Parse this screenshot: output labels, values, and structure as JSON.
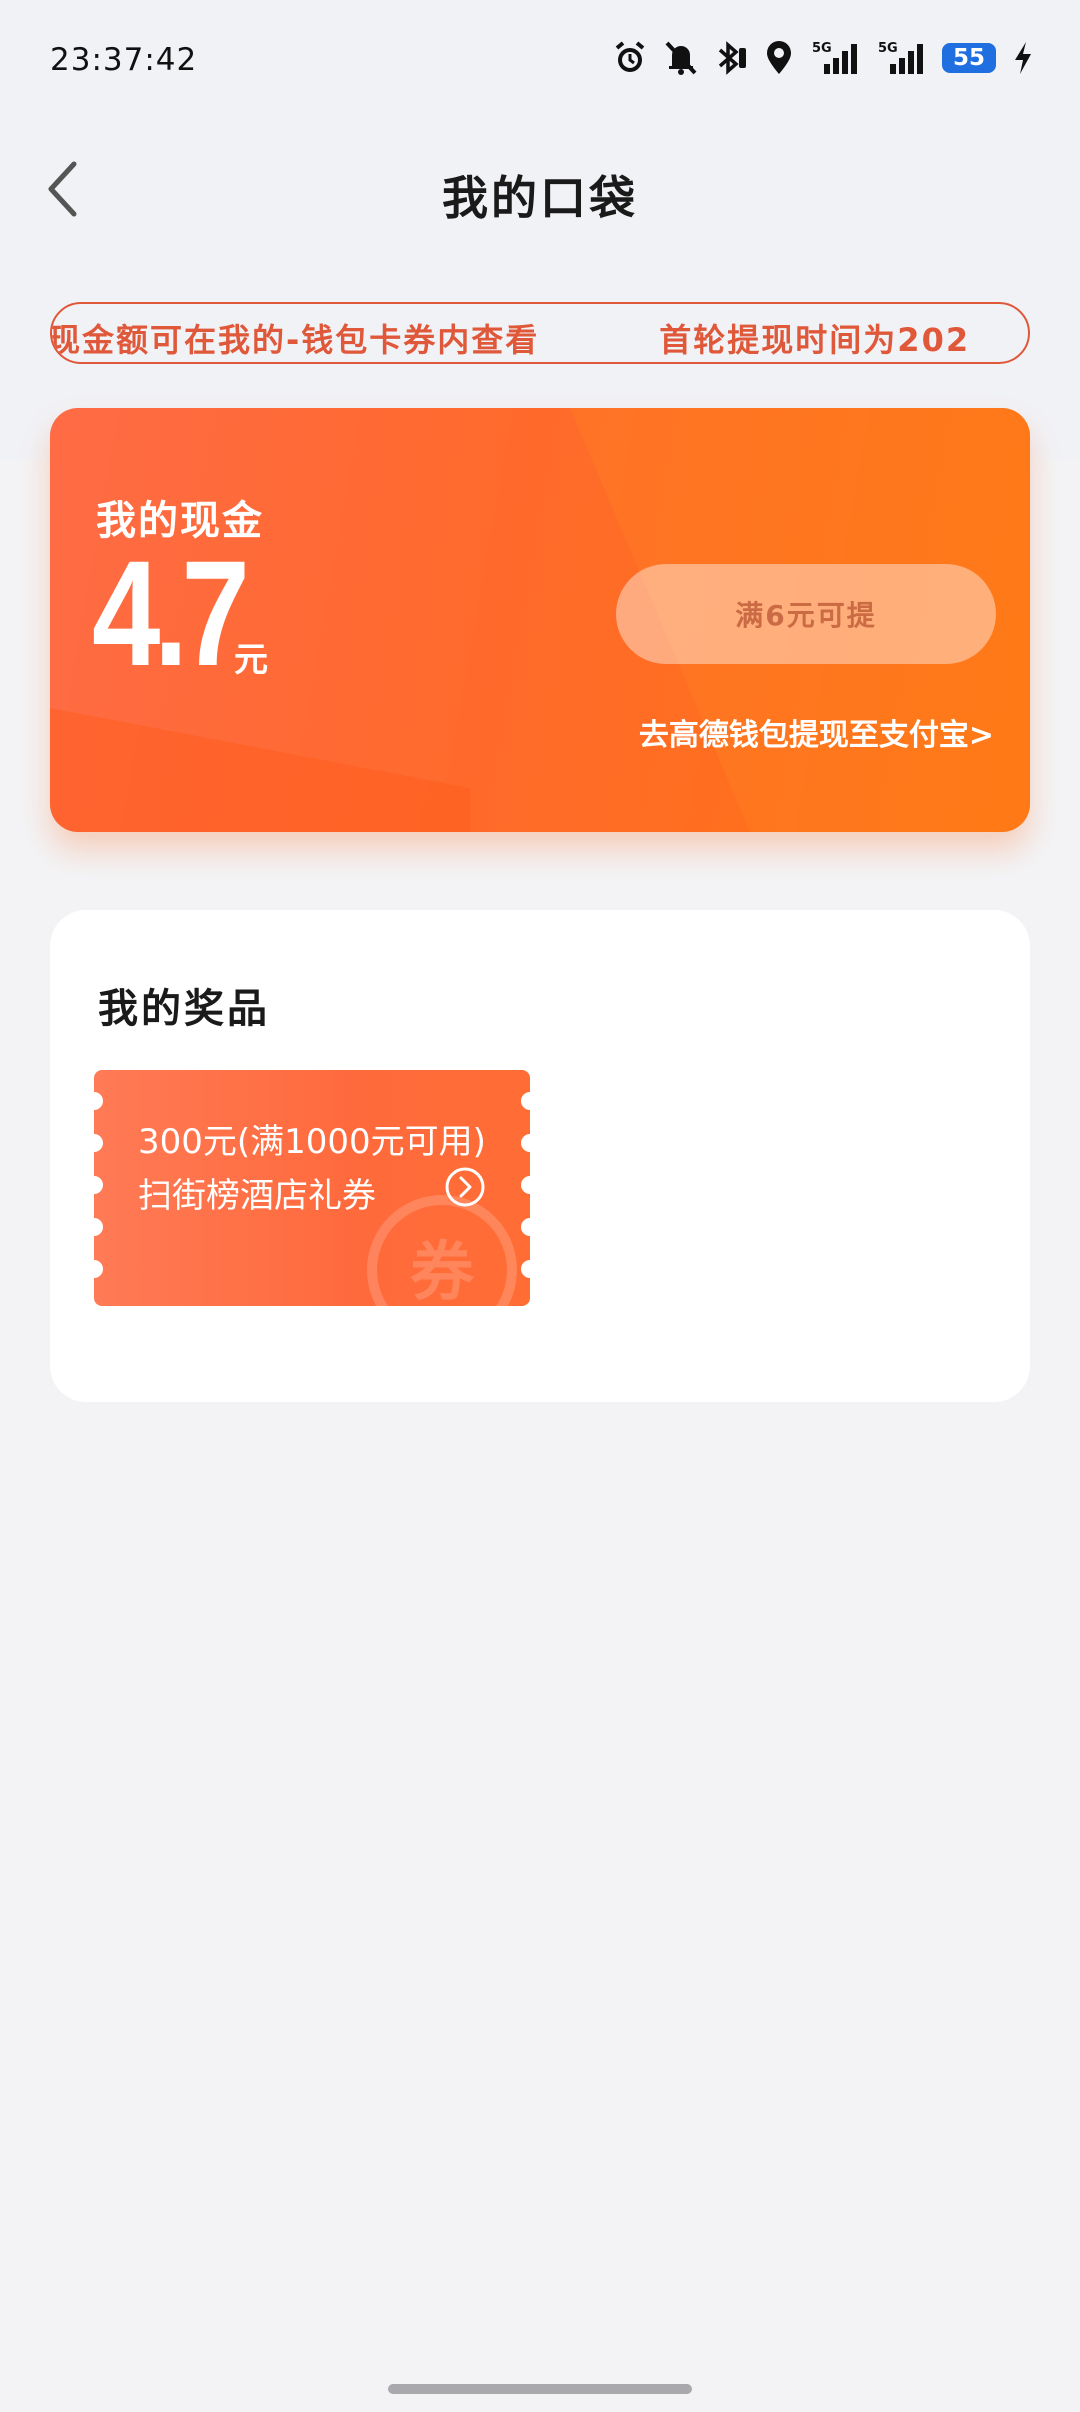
{
  "status_bar": {
    "time": "23:37:42",
    "battery": "55",
    "icons": [
      "alarm-icon",
      "mute-icon",
      "bluetooth-icon",
      "location-icon",
      "signal-5g-icon",
      "signal-5g-icon",
      "battery-icon",
      "charging-icon"
    ],
    "network_label": "5G"
  },
  "nav": {
    "back_icon": "chevron-left-icon",
    "title": "我的口袋"
  },
  "ticker": {
    "messages": [
      "现金额可在我的-钱包卡券内查看",
      "首轮提现时间为202"
    ],
    "color": "#e0583a"
  },
  "cash": {
    "label": "我的现金",
    "amount": "4.7",
    "unit": "元",
    "withdraw_button": "满6元可提",
    "withdraw_link": "去高德钱包提现至支付宝>",
    "colors": {
      "card_start": "#ff6b45",
      "card_end": "#ff7410"
    }
  },
  "prizes": {
    "title": "我的奖品",
    "items": [
      {
        "line1": "300元(满1000元可用)",
        "line2": "扫街榜酒店礼券",
        "arrow_icon": "chevron-right-circle-icon",
        "watermark": "券"
      }
    ]
  }
}
